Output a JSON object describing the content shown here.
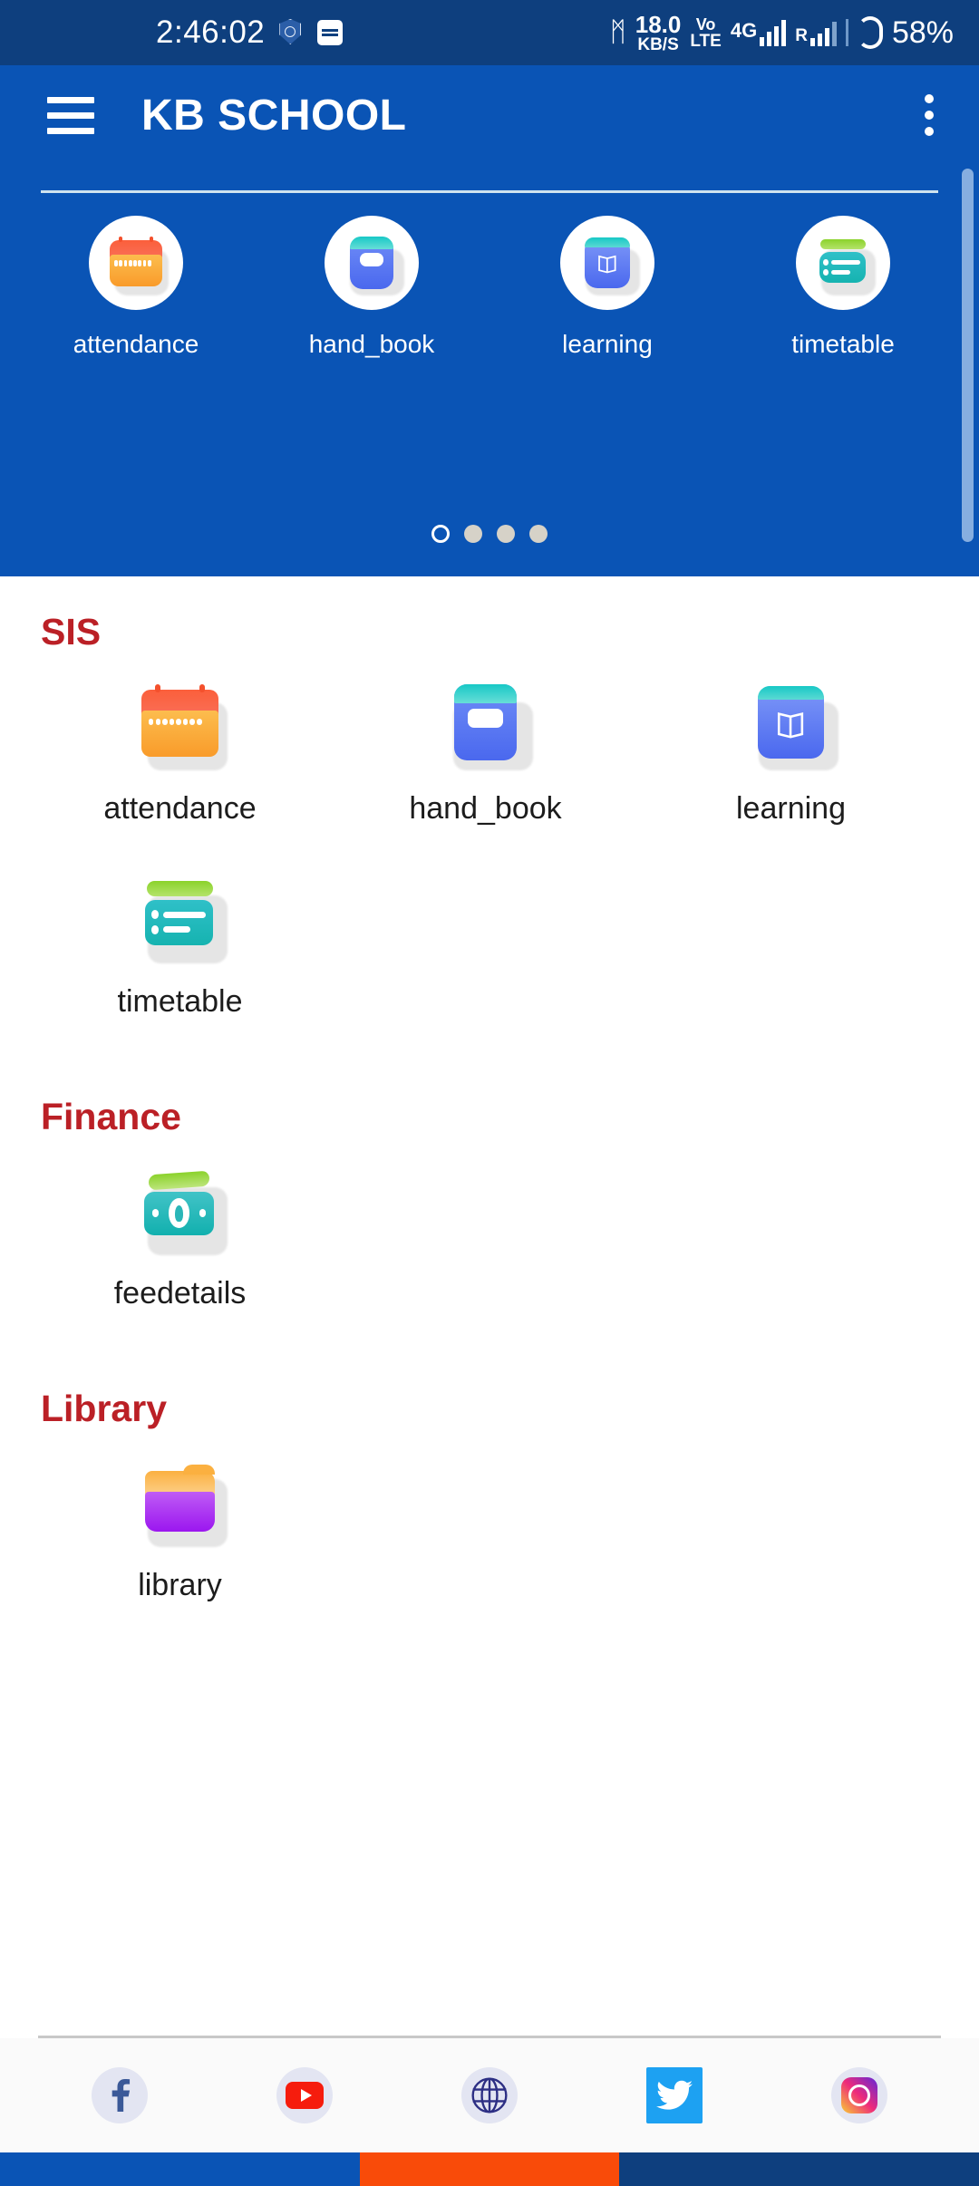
{
  "status_bar": {
    "clock": "2:46:02",
    "app_icon_name": "kb-school-shield",
    "sms_icon_name": "sms-icon",
    "bluetooth_glyph": "ᛗ",
    "data_rate_value": "18.0",
    "data_rate_unit": "KB/S",
    "volte_line1": "Vo",
    "volte_line2": "LTE",
    "network_type": "4G",
    "roaming_label": "R",
    "battery_percent": "58%",
    "background": "#0e3f7e"
  },
  "app_bar": {
    "title": "KB SCHOOL",
    "menu_icon": "hamburger-menu-icon",
    "overflow_icon": "more-vertical-icon",
    "background": "#0a54b5"
  },
  "carousel": {
    "items": [
      {
        "label": "attendance",
        "icon": "calendar-icon"
      },
      {
        "label": "hand_book",
        "icon": "notebook-icon"
      },
      {
        "label": "learning",
        "icon": "open-book-icon"
      },
      {
        "label": "timetable",
        "icon": "timetable-card-icon"
      }
    ],
    "page_count": 4,
    "active_page": 1
  },
  "sections": [
    {
      "title": "SIS",
      "tiles": [
        {
          "label": "attendance",
          "icon": "calendar-icon"
        },
        {
          "label": "hand_book",
          "icon": "notebook-icon"
        },
        {
          "label": "learning",
          "icon": "open-book-icon"
        },
        {
          "label": "timetable",
          "icon": "timetable-card-icon"
        }
      ]
    },
    {
      "title": "Finance",
      "tiles": [
        {
          "label": "feedetails",
          "icon": "banknote-icon"
        }
      ]
    },
    {
      "title": "Library",
      "tiles": [
        {
          "label": "library",
          "icon": "folder-icon"
        }
      ]
    }
  ],
  "social": [
    {
      "name": "facebook-icon",
      "glyph": "f"
    },
    {
      "name": "youtube-icon",
      "glyph": ""
    },
    {
      "name": "website-globe-icon",
      "glyph": ""
    },
    {
      "name": "twitter-icon",
      "glyph": ""
    },
    {
      "name": "instagram-icon",
      "glyph": ""
    }
  ],
  "colors": {
    "brand_blue": "#0a54b5",
    "status_blue": "#0e3f7e",
    "section_red": "#bb2026",
    "nav_orange": "#f94b09"
  }
}
